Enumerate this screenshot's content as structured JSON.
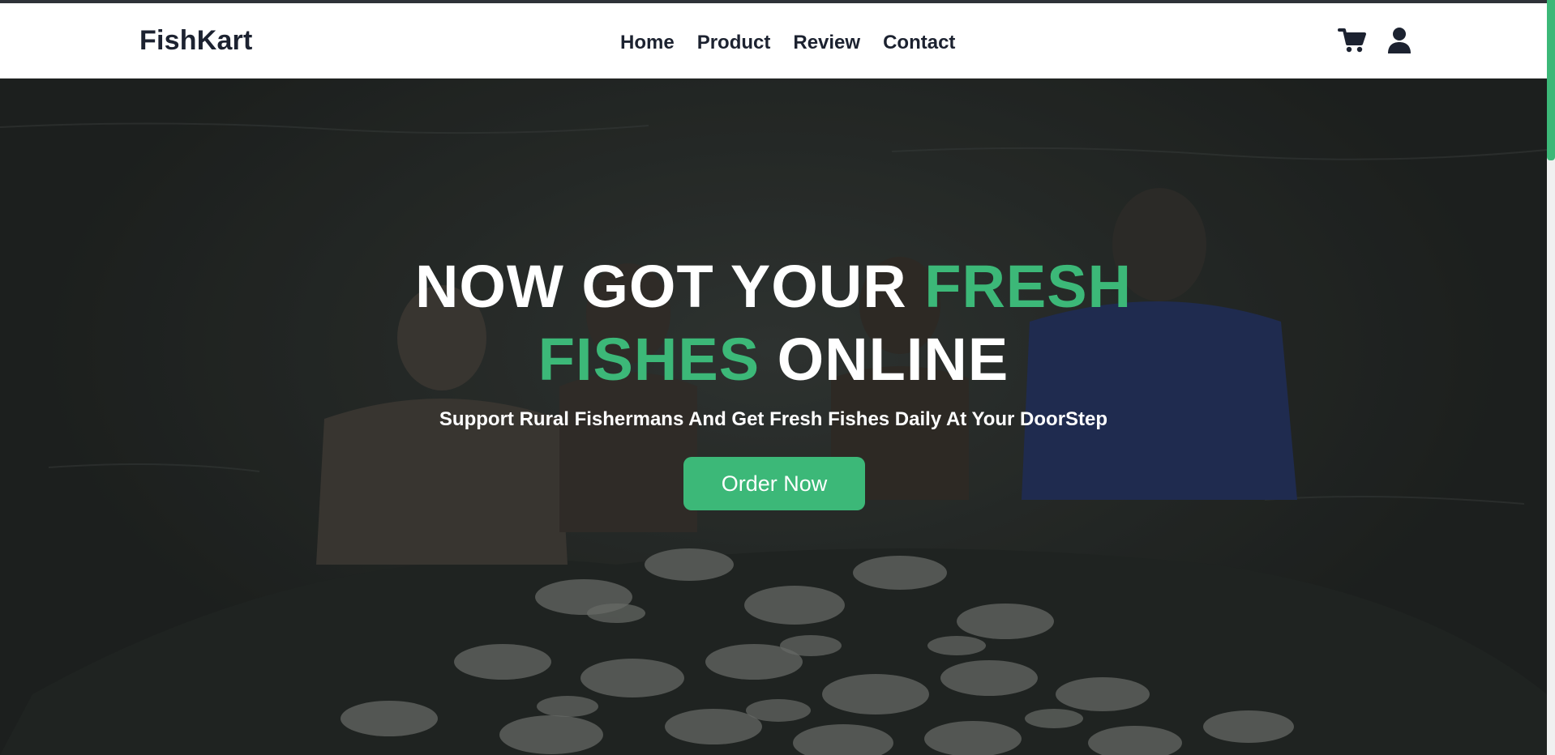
{
  "brand": {
    "name": "FishKart"
  },
  "nav": {
    "items": [
      {
        "label": "Home"
      },
      {
        "label": "Product"
      },
      {
        "label": "Review"
      },
      {
        "label": "Contact"
      }
    ]
  },
  "header_icons": [
    "cart-icon",
    "user-icon"
  ],
  "hero": {
    "headline": {
      "part1": "NOW GOT YOUR ",
      "part2_green": "FRESH",
      "part3_green": "FISHES",
      "part4": " ONLINE"
    },
    "subline": "Support Rural Fishermans And Get Fresh Fishes Daily At Your DoorStep",
    "cta_label": "Order Now"
  },
  "colors": {
    "accent": "#3cb878",
    "text_dark": "#1c2230",
    "header_bg": "#ffffff"
  }
}
